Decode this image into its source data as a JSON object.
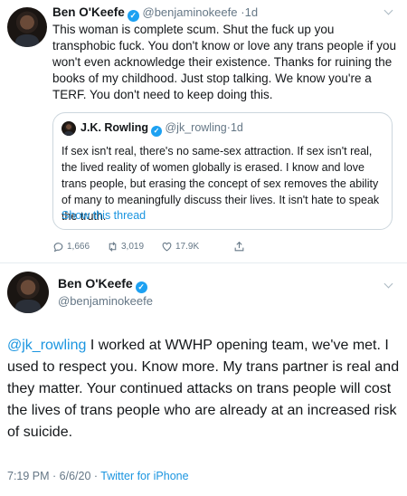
{
  "tweet1": {
    "author_name": "Ben O'Keefe",
    "handle": "@benjaminokeefe",
    "separator": "·",
    "time": "1d",
    "text": "This woman is complete scum. Shut the fuck up you transphobic fuck. You don't know or love any trans people if you won't even acknowledge their existence. Thanks for ruining the books of my childhood. Just stop talking. We know you're a TERF. You don't need to keep doing this."
  },
  "quoted": {
    "author_name": "J.K. Rowling",
    "handle": "@jk_rowling",
    "separator": "·",
    "time": "1d",
    "text": "If sex isn't real, there's no same-sex attraction. If sex isn't real, the lived reality of women globally is erased. I know and love trans people, but erasing the concept of sex removes the ability of many to meaningfully discuss their lives. It isn't hate to speak the truth.",
    "show_thread": "Show this thread"
  },
  "actions": {
    "replies": "1,666",
    "retweets": "3,019",
    "likes": "17.9K"
  },
  "tweet2": {
    "author_name": "Ben O'Keefe",
    "handle": "@benjaminokeefe",
    "mention": "@jk_rowling",
    "text": " I worked at WWHP opening team, we've met. I used to respect you. Know more. My trans partner is real and they matter. Your continued attacks on trans people will cost the lives of trans people who are already at an increased risk of suicide.",
    "timestamp": "7:19 PM · 6/6/20 · ",
    "source": "Twitter for iPhone"
  },
  "colors": {
    "link": "#1b95e0",
    "verified": "#1da1f2",
    "muted": "#657786",
    "text": "#14171a"
  }
}
